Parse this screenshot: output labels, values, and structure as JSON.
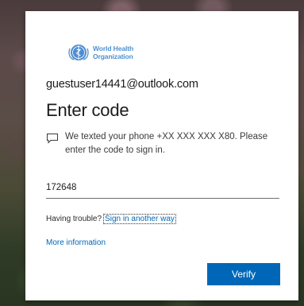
{
  "organization": {
    "logo_line1": "World Health",
    "logo_line2": "Organization"
  },
  "signin": {
    "account_email": "guestuser14441@outlook.com",
    "title": "Enter code",
    "message": "We texted your phone +XX XXX XXX X80. Please enter the code to sign in.",
    "code_value": "172648",
    "trouble_label": "Having trouble?",
    "trouble_link": "Sign in another way",
    "more_info_link": "More information",
    "verify_button": "Verify"
  },
  "icons": {
    "logo": "who-emblem-icon",
    "message": "message-bubble-icon"
  },
  "colors": {
    "accent": "#0067b8",
    "logo_blue": "#4f8fd1",
    "card_background": "#ffffff"
  }
}
